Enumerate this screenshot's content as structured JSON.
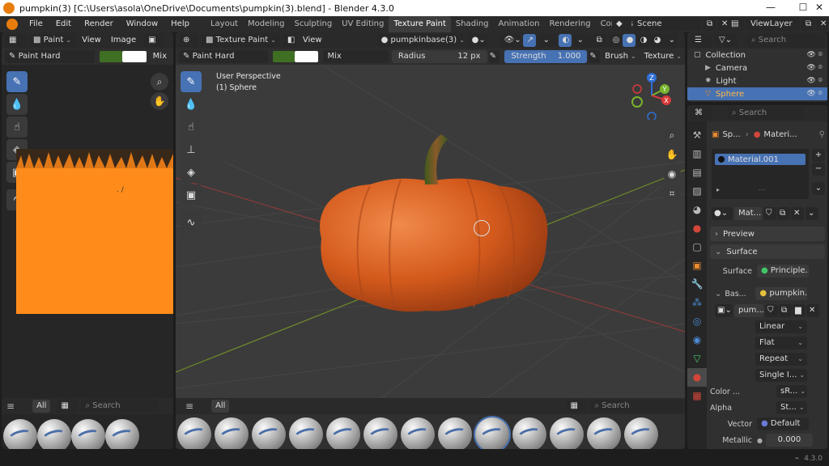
{
  "window": {
    "title": "pumpkin(3) [C:\\Users\\asola\\OneDrive\\Documents\\pumpkin(3).blend] - Blender 4.3.0",
    "version": "4.3.0"
  },
  "menu": [
    "File",
    "Edit",
    "Render",
    "Window",
    "Help"
  ],
  "workspaces": [
    "Layout",
    "Modeling",
    "Sculpting",
    "UV Editing",
    "Texture Paint",
    "Shading",
    "Animation",
    "Rendering",
    "Compositing"
  ],
  "active_workspace": "Texture Paint",
  "scene": "Scene",
  "view_layer": "ViewLayer",
  "image_editor": {
    "mode": "Paint",
    "view": "View",
    "image": "Image",
    "brush": "Paint Hard",
    "blend": "Mix",
    "colors": {
      "primary": "#3f6f22",
      "secondary": "#ffffff",
      "canvas": "#ff8c1a"
    }
  },
  "viewport": {
    "mode": "Texture Paint",
    "view": "View",
    "texture_slot": "pumpkinbase(3)",
    "brush": "Paint Hard",
    "blend": "Mix",
    "radius_label": "Radius",
    "radius_value": "12 px",
    "strength_label": "Strength",
    "strength_value": "1.000",
    "brush_menu": "Brush",
    "texture_menu": "Texture",
    "overlay_line1": "User Perspective",
    "overlay_line2": "(1) Sphere",
    "colors": {
      "primary": "#3f6f22",
      "secondary": "#ffffff",
      "background": "#3b3b3b",
      "pumpkin": "#d45a1c"
    },
    "gizmo": {
      "x": "X",
      "y": "Y",
      "z": "Z"
    }
  },
  "asset_shelf": {
    "tab": "All",
    "search_placeholder": "Search"
  },
  "outliner": {
    "search_placeholder": "Search",
    "items": [
      {
        "label": "Collection",
        "icon": "collection-icon"
      },
      {
        "label": "Camera",
        "icon": "camera-icon"
      },
      {
        "label": "Light",
        "icon": "light-icon"
      },
      {
        "label": "Sphere",
        "icon": "mesh-icon"
      }
    ]
  },
  "properties": {
    "search_placeholder": "Search",
    "breadcrumb": [
      "Sp...",
      "Materi..."
    ],
    "material_slot": "Material.001",
    "material_name": "Mat...",
    "preview": "Preview",
    "surface_panel": "Surface",
    "surface_label": "Surface",
    "surface_value": "Principle...",
    "base_label": "Bas...",
    "base_value": "pumpkin...",
    "image_name": "pum...",
    "interpolation": "Linear",
    "projection": "Flat",
    "extension": "Repeat",
    "source": "Single I...",
    "color_label": "Color ...",
    "color_value": "sR...",
    "alpha_label": "Alpha",
    "alpha_value": "St...",
    "vector_label": "Vector",
    "vector_value": "Default",
    "metallic_label": "Metallic",
    "metallic_value": "0.000"
  }
}
